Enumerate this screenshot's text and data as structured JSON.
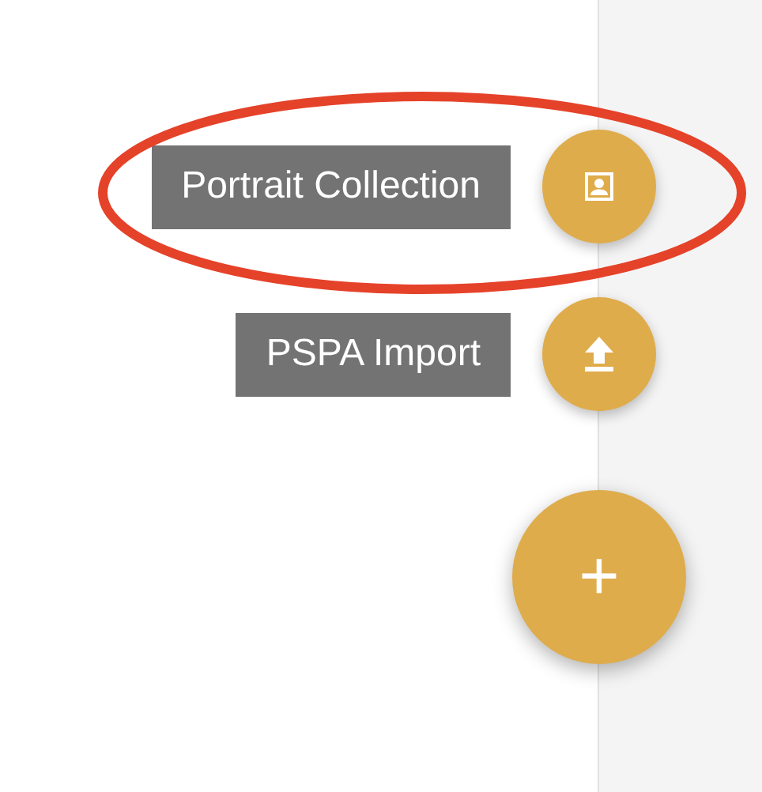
{
  "actions": [
    {
      "label": "Portrait Collection",
      "kind": "portrait",
      "highlighted": true
    },
    {
      "label": "PSPA Import",
      "kind": "upload",
      "highlighted": false
    }
  ],
  "main_button": {
    "label": "+"
  }
}
